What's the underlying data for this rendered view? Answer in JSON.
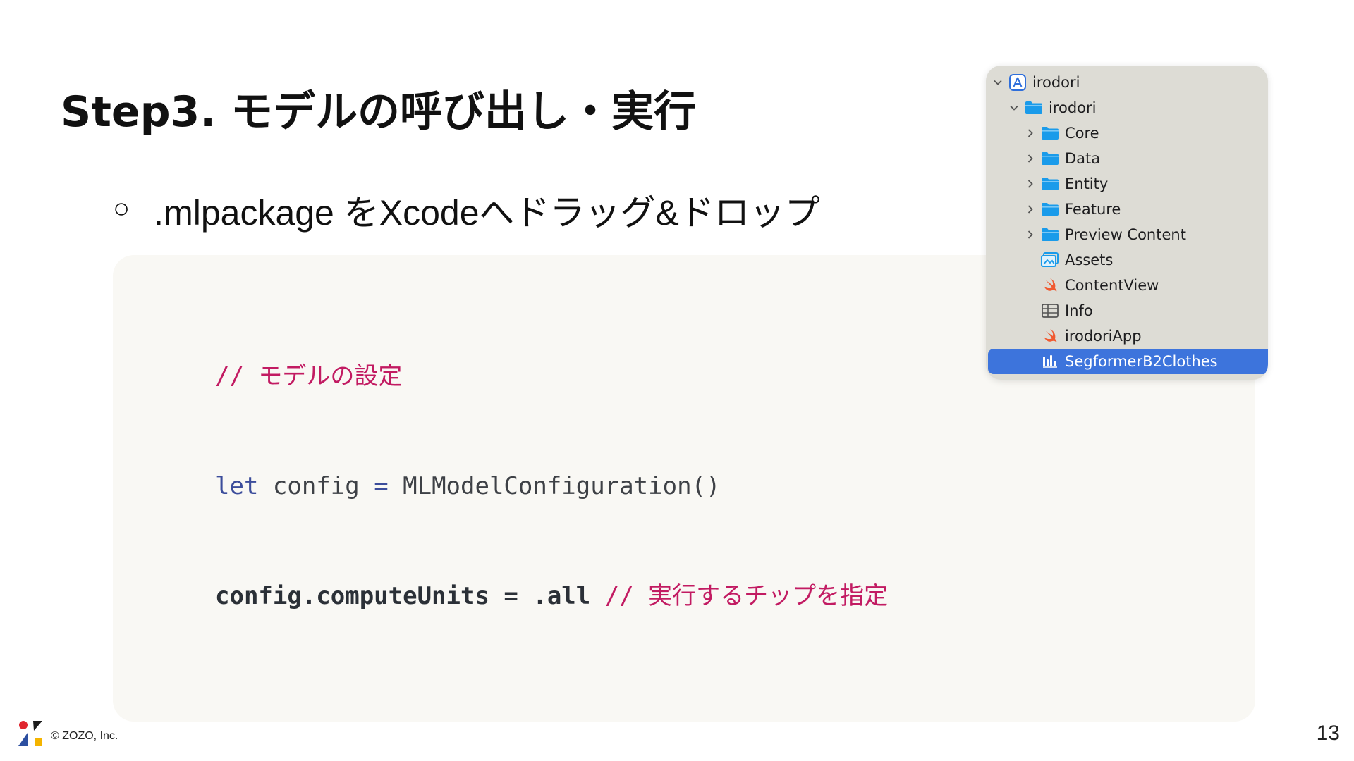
{
  "slide": {
    "title": "Step3. モデルの呼び出し・実行",
    "bullet_mark": "○",
    "bullet_text": ".mlpackage をXcodeへドラッグ&ドロップ"
  },
  "code": {
    "line1": {
      "comment": "// モデルの設定"
    },
    "line2": {
      "keyword": "let",
      "name": " config ",
      "op": "=",
      "value": " MLModelConfiguration()"
    },
    "line3": {
      "target": "config.computeUnits ",
      "op": "=",
      "value": " .all ",
      "comment": "// 実行するチップを指定"
    }
  },
  "navigator": {
    "items": [
      {
        "label": "irodori",
        "icon": "xcode-project-icon",
        "expanded": true
      },
      {
        "label": "irodori",
        "icon": "folder-icon",
        "expanded": true
      },
      {
        "label": "Core",
        "icon": "folder-icon",
        "expanded": false
      },
      {
        "label": "Data",
        "icon": "folder-icon",
        "expanded": false
      },
      {
        "label": "Entity",
        "icon": "folder-icon",
        "expanded": false
      },
      {
        "label": "Feature",
        "icon": "folder-icon",
        "expanded": false
      },
      {
        "label": "Preview Content",
        "icon": "folder-icon",
        "expanded": false
      },
      {
        "label": "Assets",
        "icon": "asset-catalog-icon"
      },
      {
        "label": "ContentView",
        "icon": "swift-file-icon"
      },
      {
        "label": "Info",
        "icon": "plist-table-icon"
      },
      {
        "label": "irodoriApp",
        "icon": "swift-file-icon"
      },
      {
        "label": "SegformerB2Clothes",
        "icon": "mlmodel-icon",
        "selected": true
      }
    ]
  },
  "footer": {
    "copyright": "© ZOZO, Inc.",
    "page_number": "13"
  },
  "colors": {
    "comment": "#c21b62",
    "keyword": "#3c4d9b",
    "selection": "#3d74dc",
    "folder": "#1a9bea"
  }
}
